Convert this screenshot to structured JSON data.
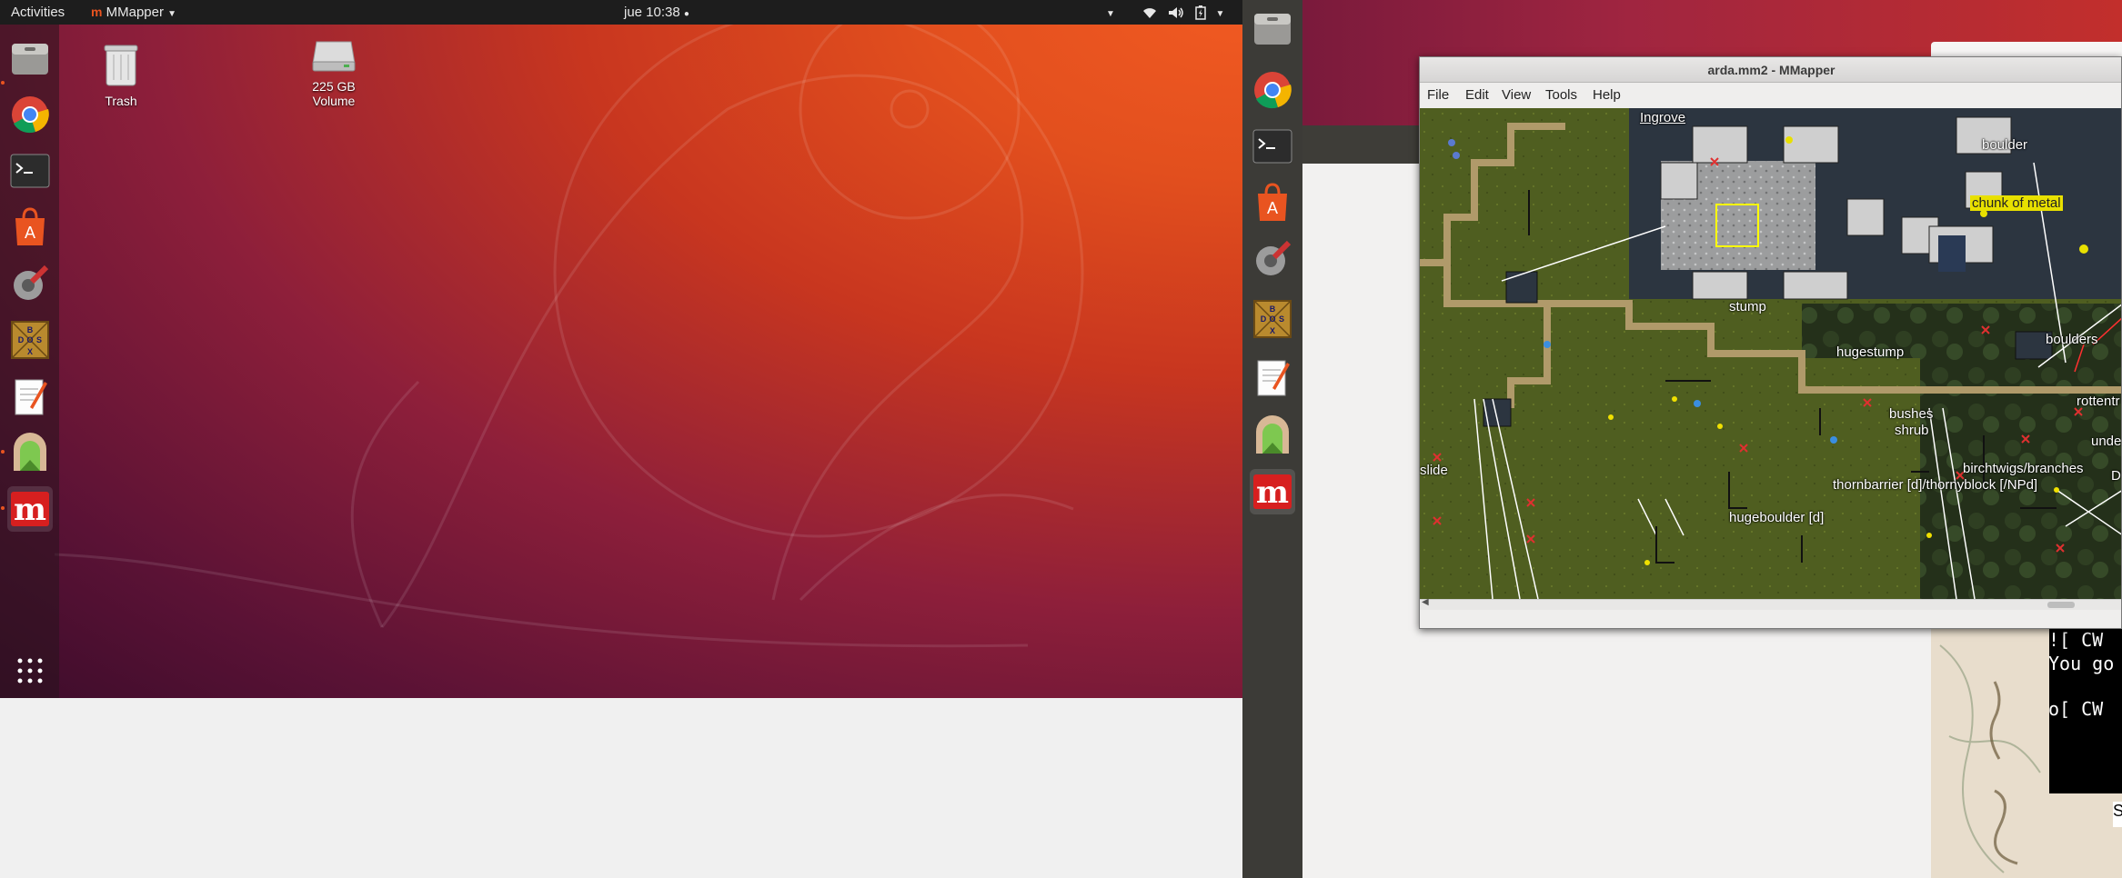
{
  "left_screen": {
    "topbar": {
      "activities": "Activities",
      "app_menu": "MMapper",
      "clock": "jue 10:38",
      "clock_dot": "●"
    },
    "desktop_icons": [
      {
        "label": "Trash",
        "icon": "trash-icon"
      },
      {
        "label": "225 GB Volume",
        "icon": "drive-icon"
      }
    ],
    "dock": [
      {
        "name": "files",
        "icon": "files-icon"
      },
      {
        "name": "chrome",
        "icon": "chrome-icon"
      },
      {
        "name": "terminal",
        "icon": "terminal-icon"
      },
      {
        "name": "software",
        "icon": "software-icon"
      },
      {
        "name": "settings",
        "icon": "tools-icon"
      },
      {
        "name": "dosbox",
        "icon": "dosbox-icon",
        "letters": "BOXDS"
      },
      {
        "name": "text-editor",
        "icon": "text-editor-icon"
      },
      {
        "name": "gate",
        "icon": "gate-icon"
      },
      {
        "name": "mmapper",
        "icon": "mmapper-icon",
        "letter": "m"
      }
    ],
    "show_apps": "show-apps-icon"
  },
  "mmapper_window": {
    "title": "arda.mm2 - MMapper",
    "menu": [
      "File",
      "Edit",
      "View",
      "Tools",
      "Help"
    ],
    "map_labels": {
      "ingrove": "Ingrove",
      "boulder": "boulder",
      "chunk_of_metal": "chunk of metal",
      "stump": "stump",
      "hugestump": "hugestump",
      "boulders": "boulders",
      "rotten": "rottentr",
      "bushes": "bushes",
      "shrub": "shrub",
      "under": "unde",
      "birchtwigs": "birchtwigs/branches",
      "thornbarrier": "thornbarrier [d]/thornyblock [/NPd]",
      "slide": "slide",
      "hugeboulder": "hugeboulder [d]",
      "dt": "DT"
    }
  },
  "terminal": {
    "lines": [
      "![ CW",
      "You go",
      "o[ CW "
    ],
    "s_char": "S"
  },
  "colors": {
    "accent": "#e95420",
    "topbar": "#1d1d1d",
    "dock": "#3c3b37",
    "grass": "#4b5a1e",
    "highlight": "#ffff00"
  }
}
